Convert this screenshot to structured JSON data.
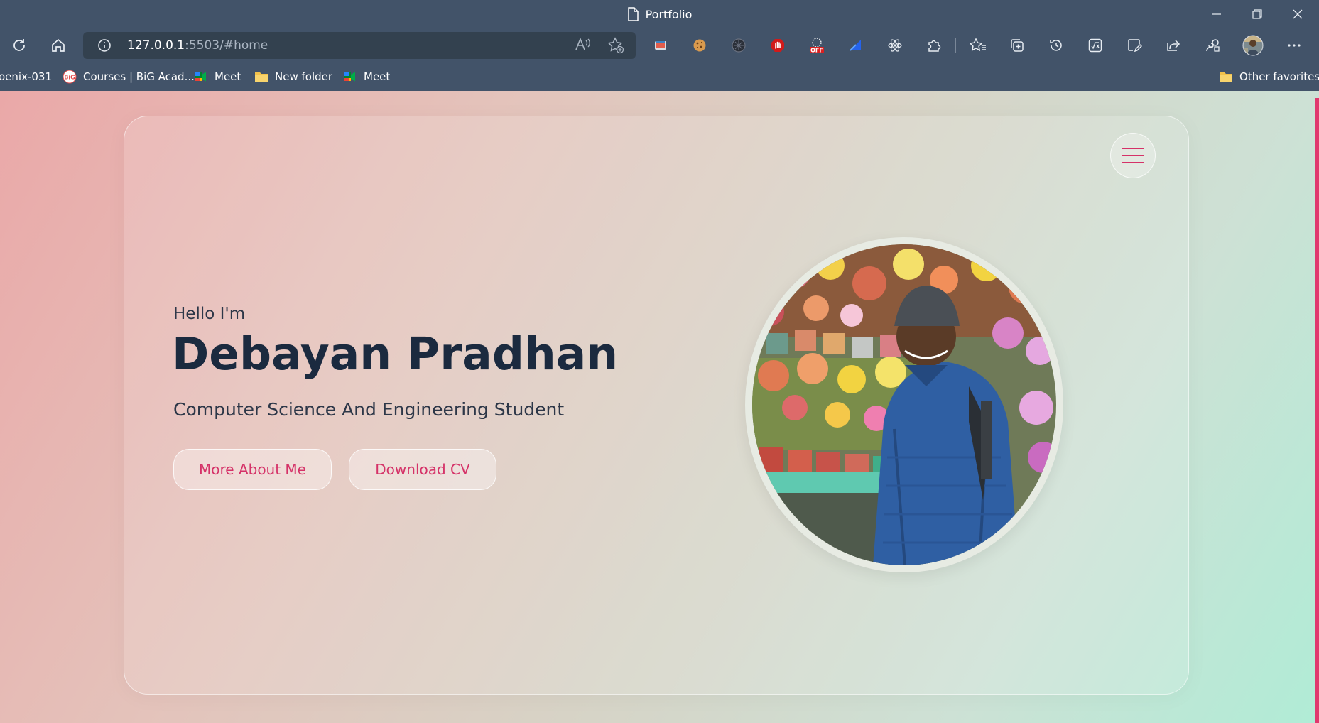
{
  "window": {
    "title": "Portfolio"
  },
  "address_bar": {
    "host": "127.0.0.1",
    "rest": ":5503/#home"
  },
  "bookmarks": {
    "items": [
      {
        "label": "oenix-031"
      },
      {
        "label": "Courses | BiG Acad..."
      },
      {
        "label": "Meet"
      },
      {
        "label": "New folder"
      },
      {
        "label": "Meet"
      }
    ],
    "other": "Other favorites"
  },
  "hero": {
    "greeting": "Hello I'm",
    "name": "Debayan Pradhan",
    "role": "Computer Science And Engineering Student",
    "buttons": {
      "more": "More About Me",
      "cv": "Download CV"
    }
  },
  "colors": {
    "accent": "#d53268",
    "heading": "#1b2a3f",
    "browser_chrome": "#425369"
  },
  "icons": [
    "page-icon",
    "minimize-icon",
    "maximize-icon",
    "close-icon",
    "refresh-icon",
    "home-icon",
    "info-icon",
    "read-aloud-icon",
    "add-favorite-icon",
    "extension-icons",
    "favorites-icon",
    "collections-icon",
    "history-icon",
    "math-solver-icon",
    "web-capture-icon",
    "share-icon",
    "performance-icon",
    "profile-avatar",
    "more-icon",
    "folder-icon",
    "hamburger-menu-icon",
    "profile-photo"
  ]
}
